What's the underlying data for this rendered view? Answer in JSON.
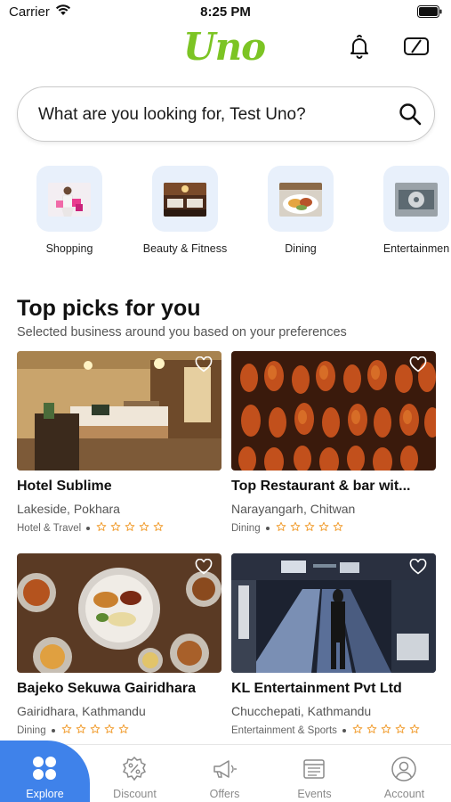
{
  "status_bar": {
    "carrier": "Carrier",
    "time": "8:25 PM"
  },
  "header": {
    "logo": "Uno",
    "icons": [
      "bell-icon",
      "switch-icon"
    ]
  },
  "search": {
    "placeholder": "What are you looking for, Test Uno?"
  },
  "categories": [
    {
      "label": "Shopping"
    },
    {
      "label": "Beauty & Fitness"
    },
    {
      "label": "Dining"
    },
    {
      "label": "Entertainmen"
    }
  ],
  "section": {
    "title": "Top picks for you",
    "subtitle": "Selected business around you based on your preferences"
  },
  "cards": [
    {
      "name": "Hotel Sublime",
      "location": "Lakeside, Pokhara",
      "category": "Hotel & Travel",
      "rating": 0
    },
    {
      "name": "Top Restaurant & bar wit...",
      "location": "Narayangarh, Chitwan",
      "category": "Dining",
      "rating": 0
    },
    {
      "name": "Bajeko Sekuwa Gairidhara",
      "location": "Gairidhara, Kathmandu",
      "category": "Dining",
      "rating": 0
    },
    {
      "name": "KL Entertainment  Pvt  Ltd",
      "location": "Chucchepati, Kathmandu",
      "category": "Entertainment & Sports",
      "rating": 0
    }
  ],
  "tabs": [
    {
      "label": "Explore",
      "active": true
    },
    {
      "label": "Discount",
      "active": false
    },
    {
      "label": "Offers",
      "active": false
    },
    {
      "label": "Events",
      "active": false
    },
    {
      "label": "Account",
      "active": false
    }
  ],
  "colors": {
    "brand_green": "#7cc424",
    "accent_blue": "#3f82ea",
    "star_orange": "#f2a23a"
  }
}
